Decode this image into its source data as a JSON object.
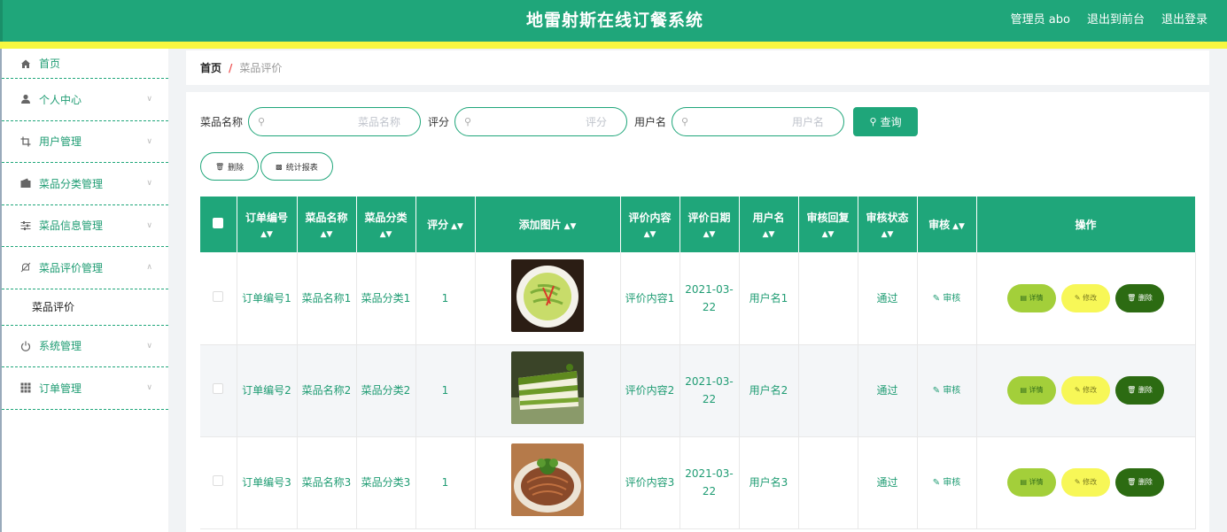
{
  "header": {
    "title": "地雷射斯在线订餐系统",
    "user": "管理员 abo",
    "to_front": "退出到前台",
    "logout": "退出登录"
  },
  "sidebar": {
    "items": [
      {
        "label": "首页",
        "icon": "home-icon"
      },
      {
        "label": "个人中心",
        "icon": "user-icon"
      },
      {
        "label": "用户管理",
        "icon": "crop-icon"
      },
      {
        "label": "菜品分类管理",
        "icon": "wallet-icon"
      },
      {
        "label": "菜品信息管理",
        "icon": "sliders-icon"
      },
      {
        "label": "菜品评价管理",
        "icon": "bell-off-icon"
      },
      {
        "label": "系统管理",
        "icon": "power-icon"
      },
      {
        "label": "订单管理",
        "icon": "grid-icon"
      }
    ],
    "submenu": "菜品评价"
  },
  "breadcrumb": {
    "home": "首页",
    "sep": "/",
    "current": "菜品评价"
  },
  "search": {
    "dish_label": "菜品名称",
    "dish_placeholder": "菜品名称",
    "score_label": "评分",
    "score_placeholder": "评分",
    "user_label": "用户名",
    "user_placeholder": "用户名",
    "query": "查询"
  },
  "actions": {
    "delete": "删除",
    "report": "统计报表"
  },
  "table": {
    "headers": [
      "订单编号",
      "菜品名称",
      "菜品分类",
      "评分",
      "添加图片",
      "评价内容",
      "评价日期",
      "用户名",
      "审核回复",
      "审核状态",
      "审核",
      "操作"
    ],
    "rows": [
      {
        "order": "订单编号1",
        "dish": "菜品名称1",
        "cat": "菜品分类1",
        "score": "1",
        "content": "评价内容1",
        "date": "2021-03-22",
        "user": "用户名1",
        "reply": "",
        "status": "通过",
        "audit": "审核"
      },
      {
        "order": "订单编号2",
        "dish": "菜品名称2",
        "cat": "菜品分类2",
        "score": "1",
        "content": "评价内容2",
        "date": "2021-03-22",
        "user": "用户名2",
        "reply": "",
        "status": "通过",
        "audit": "审核"
      },
      {
        "order": "订单编号3",
        "dish": "菜品名称3",
        "cat": "菜品分类3",
        "score": "1",
        "content": "评价内容3",
        "date": "2021-03-22",
        "user": "用户名3",
        "reply": "",
        "status": "通过",
        "audit": "审核"
      }
    ],
    "ops": {
      "detail": "详情",
      "edit": "修改",
      "delete": "删除"
    }
  },
  "colors": {
    "primary": "#1fa67a",
    "yellow_bar": "#f7f740",
    "detail_btn": "#a3cf3a",
    "edit_btn": "#f7f757",
    "delete_btn": "#2c6b12"
  }
}
